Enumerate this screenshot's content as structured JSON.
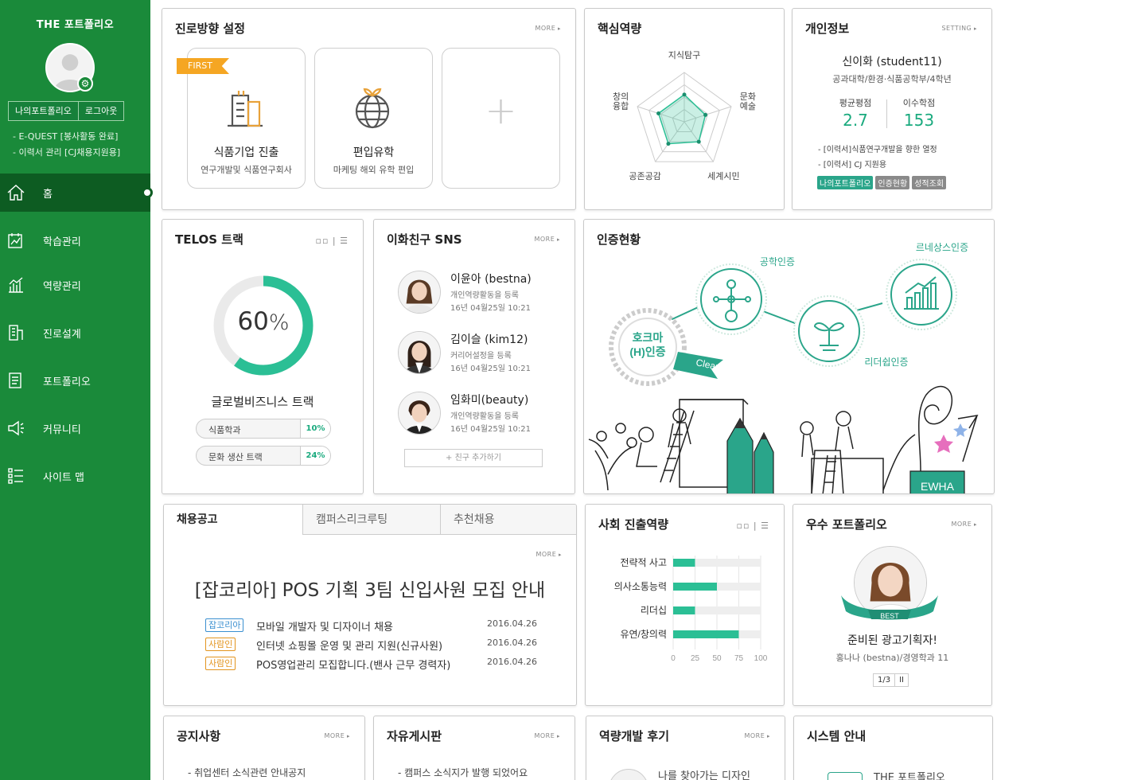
{
  "sidebar": {
    "brand": "THE 포트폴리오",
    "buttons": [
      "나의포트폴리오",
      "로그아웃"
    ],
    "status": [
      "- E-QUEST [봉사활동 완료]",
      "- 이력서 관리 [CJ채용지원용]"
    ],
    "nav": [
      {
        "label": "홈",
        "icon": "home-icon"
      },
      {
        "label": "학습관리",
        "icon": "study-icon"
      },
      {
        "label": "역량관리",
        "icon": "chart-icon"
      },
      {
        "label": "진로설계",
        "icon": "building-icon"
      },
      {
        "label": "포트폴리오",
        "icon": "document-icon"
      },
      {
        "label": "커뮤니티",
        "icon": "megaphone-icon"
      },
      {
        "label": "사이트 맵",
        "icon": "sitemap-icon"
      }
    ]
  },
  "career": {
    "title": "진로방향 설정",
    "more": "MORE",
    "first_tag": "FIRST",
    "boxes": [
      {
        "title": "식품기업 진출",
        "sub": "연구개발및 식품연구회사"
      },
      {
        "title": "편입유학",
        "sub": "마케팅 해외 유학 편입"
      }
    ],
    "add": "+"
  },
  "core": {
    "title": "핵심역량",
    "labels": [
      "지식탐구",
      "문화\n예술",
      "세계시민",
      "공존공감",
      "창의\n융합"
    ],
    "values": [
      0.55,
      0.45,
      0.5,
      0.55,
      0.55
    ]
  },
  "personal": {
    "title": "개인정보",
    "setting": "SETTING",
    "name": "신이화 (student11)",
    "dept": "공과대학/환경·식품공학부/4학년",
    "gpa_label": "평균평점",
    "gpa": "2.7",
    "credits_label": "이수학점",
    "credits": "153",
    "list": [
      "- [이력서]식품연구개발을 향한 열정",
      "- [이력서] CJ 지원용"
    ],
    "tags": [
      {
        "label": "나의포트폴리오",
        "color": "#2aa58a"
      },
      {
        "label": "인증현황",
        "color": "#8a8a8a"
      },
      {
        "label": "성적조회",
        "color": "#8a8a8a"
      }
    ]
  },
  "telos": {
    "title": "TELOS 트랙",
    "percent": "60",
    "percent_value": 0.6,
    "unit": "%",
    "track": "글로벌비즈니스 트랙",
    "items": [
      {
        "label": "식품학과",
        "value": "10%"
      },
      {
        "label": "문화 생산 트랙",
        "value": "24%"
      }
    ]
  },
  "sns": {
    "title": "이화친구 SNS",
    "more": "MORE",
    "friends": [
      {
        "name": "이윤아 (bestna)",
        "action": "개인역량활동을 등록",
        "date": "16년 04월25일 10:21"
      },
      {
        "name": "김이슬 (kim12)",
        "action": "커리어설정을 등록",
        "date": "16년 04월25일 10:21"
      },
      {
        "name": "임화미(beauty)",
        "action": "개인역량활동을 등록",
        "date": "16년 04월25일 10:21"
      }
    ],
    "add": "+ 친구 추가하기"
  },
  "cert": {
    "title": "인증현황",
    "items": [
      "공학인증",
      "르네상스인증",
      "리더쉽인증"
    ],
    "hokma": "호크마\n(H)인증",
    "clear": "Clear",
    "ewha": "EWHA"
  },
  "jobs": {
    "tabs": [
      "채용공고",
      "캠퍼스리크루팅",
      "추천채용"
    ],
    "more": "MORE",
    "headline": "[잡코리아] POS 기획 3팀 신입사원 모집 안내",
    "rows": [
      {
        "tag": "잡코리아",
        "tag_color": "#3a8fd0",
        "text": "모바일 개발자 및 디자이너 채용",
        "date": "2016.04.26"
      },
      {
        "tag": "사람인",
        "tag_color": "#e3941e",
        "text": "인터넷 쇼핑몰 운영 및 관리 지원(신규사원)",
        "date": "2016.04.26"
      },
      {
        "tag": "사람인",
        "tag_color": "#e3941e",
        "text": "POS영업관리 모집합니다.(밴사 근무 경력자)",
        "date": "2016.04.26"
      }
    ]
  },
  "social": {
    "title": "사회 진출역량",
    "chart_data": {
      "type": "bar",
      "categories": [
        "전략적 사고",
        "의사소통능력",
        "리더십",
        "유연/창의력"
      ],
      "values": [
        25,
        50,
        25,
        75
      ],
      "xlim": [
        0,
        100
      ],
      "ticks": [
        "0",
        "25",
        "50",
        "75",
        "100"
      ]
    }
  },
  "best": {
    "title": "우수 포트폴리오",
    "more": "MORE",
    "badge": "BEST",
    "headline": "준비된 광고기획자!",
    "sub": "홍나나 (bestna)/경영학과 11",
    "page": "1/3",
    "pause": "II"
  },
  "notice": {
    "title": "공지사항",
    "more": "MORE",
    "first": "- 취업센터 소식관련 안내공지"
  },
  "board": {
    "title": "자유게시판",
    "more": "MORE",
    "first": "- 캠퍼스 소식지가 발행 되었어요"
  },
  "review": {
    "title": "역량개발 후기",
    "more": "MORE",
    "first": "나를 찾아가는 디자인"
  },
  "system": {
    "title": "시스템 안내",
    "first": "THE 포트폴리오"
  },
  "colors": {
    "sidebar": "#1a8a3a",
    "sidebar_active": "#0d5c22",
    "accent": "#2bbf95"
  }
}
